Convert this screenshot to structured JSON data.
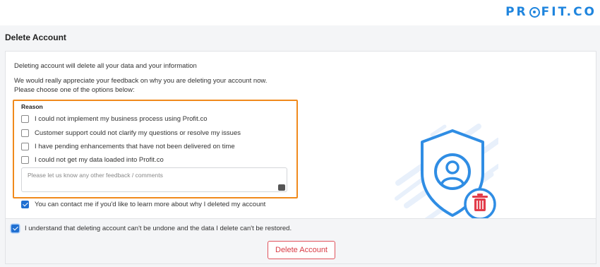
{
  "brand": {
    "logo_text_left": "PR",
    "logo_text_right": "FIT.CO",
    "color": "#1f85de"
  },
  "page": {
    "title": "Delete Account"
  },
  "intro": {
    "line1": "Deleting account will delete all your data and your information",
    "line2": "We would really appreciate your feedback on why you are deleting your account now. Please choose one of the options below:"
  },
  "reason": {
    "title": "Reason",
    "options": [
      {
        "label": "I could not implement my business process using Profit.co",
        "checked": false
      },
      {
        "label": "Customer support could not clarify my questions or resolve my issues",
        "checked": false
      },
      {
        "label": "I have pending enhancements that have not been delivered on time",
        "checked": false
      },
      {
        "label": "I could not get my data loaded into Profit.co",
        "checked": false
      }
    ],
    "feedback_placeholder": "Please let us know any other feedback / comments",
    "feedback_value": "",
    "highlight_color": "#f08a1c"
  },
  "contact": {
    "label": "You can contact me if you'd like to learn more about why I deleted my account",
    "checked": true
  },
  "confirm": {
    "label": "I understand that deleting account can't be undone and the data I delete can't be restored.",
    "checked": true
  },
  "actions": {
    "delete_label": "Delete Account",
    "delete_color": "#d93b45"
  },
  "illustration": {
    "icon": "shield-user-delete-icon",
    "accent": "#2f8de4"
  }
}
